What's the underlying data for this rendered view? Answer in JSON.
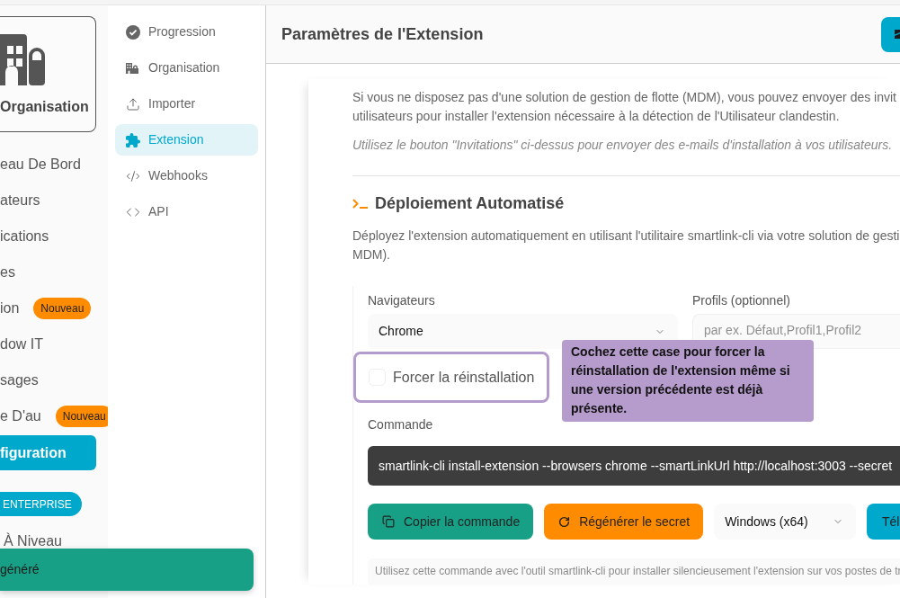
{
  "sidebar": {
    "org_card": {
      "label": "Organisation"
    },
    "nav": [
      {
        "label": "eau De Bord",
        "selected": false
      },
      {
        "label": "ateurs",
        "selected": false
      },
      {
        "label": "ications",
        "selected": false
      },
      {
        "label": "es",
        "selected": false
      },
      {
        "label": "ion",
        "badge": "Nouveau",
        "selected": false
      },
      {
        "label": "dow IT",
        "selected": false
      },
      {
        "label": "sages",
        "selected": false
      },
      {
        "label": "e D'au",
        "badge": "Nouveau",
        "selected": false
      },
      {
        "label": "figuration",
        "selected": true
      }
    ],
    "plan_badge": "ENTERPRISE",
    "nav_bottom": [
      {
        "label": "À Niveau",
        "selected": false
      }
    ]
  },
  "settings_menu": [
    {
      "label": "Progression",
      "selected": false
    },
    {
      "label": "Organisation",
      "selected": false
    },
    {
      "label": "Importer",
      "selected": false
    },
    {
      "label": "Extension",
      "selected": true
    },
    {
      "label": "Webhooks",
      "selected": false
    },
    {
      "label": "API",
      "selected": false
    }
  ],
  "header": {
    "title": "Paramètres de l'Extension"
  },
  "invitations": {
    "lines": [
      "Si vous ne disposez pas d'une solution de gestion de flotte (MDM), vous pouvez envoyer des invit",
      "utilisateurs pour installer l'extension nécessaire à la détection de l'Utilisateur clandestin."
    ],
    "hint": "Utilisez le bouton \"Invitations\" ci-dessus pour envoyer des e-mails d'installation à vos utilisateurs."
  },
  "deployment": {
    "title": "Déploiement Automatisé",
    "description_lines": [
      "Déployez l'extension automatiquement en utilisant l'utilitaire smartlink-cli via votre solution de gesti",
      "MDM)."
    ],
    "browsers": {
      "label": "Navigateurs",
      "value": "Chrome"
    },
    "profiles": {
      "label": "Profils (optionnel)",
      "placeholder": "par ex. Défaut,Profil1,Profil2"
    },
    "force_reinstall": {
      "label": "Forcer la réinstallation",
      "checked": false,
      "highlighted": true
    },
    "tooltip": {
      "text": "Cochez cette case pour forcer la réinstallation de l'extension même si une version précédente est déjà présente."
    },
    "command": {
      "label": "Commande",
      "value": "smartlink-cli install-extension --browsers chrome --smartLinkUrl http://localhost:3003 --secret"
    },
    "actions": [
      {
        "kind": "button",
        "label": "Copier la commande",
        "color": "#17a086"
      },
      {
        "kind": "button",
        "label": "Régénérer le secret",
        "color": "#ff8c00"
      },
      {
        "kind": "select",
        "value": "Windows (x64)"
      },
      {
        "kind": "button",
        "label": "Tél",
        "color": "#00a8cc"
      }
    ],
    "hint": "Utilisez cette commande avec l'outil smartlink-cli pour installer silencieusement l'extension sur vos postes de tr"
  },
  "toast": {
    "text": "généré"
  }
}
